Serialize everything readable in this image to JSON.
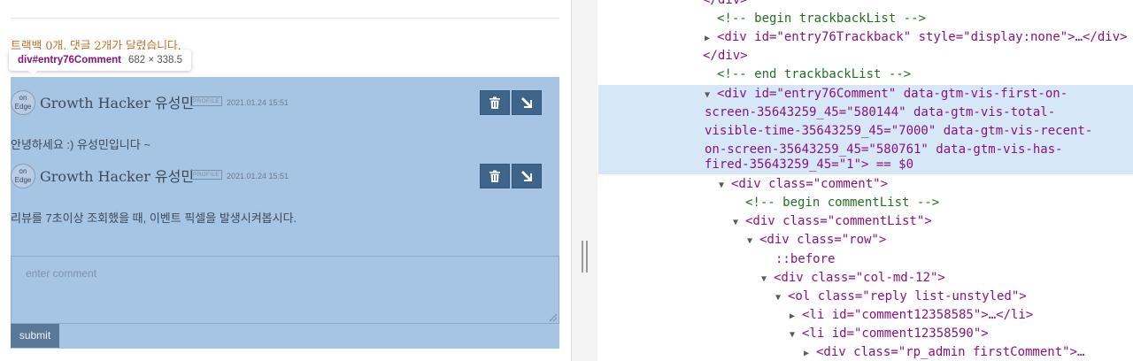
{
  "page": {
    "trackback_summary": "트랙백 0개, 댓글 2개가 달렸습니다.",
    "tooltip": {
      "selector": "div#entry76Comment",
      "dimensions": "682 × 338.5"
    },
    "avatar_text": "on Edge",
    "comments": [
      {
        "author": "Growth Hacker 유성민",
        "badge": "PROFILE",
        "timestamp": "2021.01.24 15:51",
        "body": "안녕하세요 :) 유성민입니다 ~"
      },
      {
        "author": "Growth Hacker 유성민",
        "badge": "PROFILE",
        "timestamp": "2021.01.24 15:51",
        "body": "리뷰를 7초이상 조회했을 때, 이벤트 픽셀을 발생시켜봅시다."
      }
    ],
    "comment_placeholder": "enter comment",
    "submit_label": "submit",
    "icons": {
      "delete": "trash-icon",
      "reply": "arrow-down-right-icon"
    }
  },
  "devtools": {
    "lines": {
      "l1": "</div>",
      "l2": "<!-- begin trackbackList -->",
      "l3": "<div id=\"entry76Trackback\" style=\"display:none\">…</div>",
      "l4": "</div>",
      "l5": "<!-- end trackbackList -->",
      "l6": "<div id=\"entry76Comment\" data-gtm-vis-first-on-",
      "l7": "screen-35643259_45=\"580144\" data-gtm-vis-total-",
      "l8": "visible-time-35643259_45=\"7000\" data-gtm-vis-recent-",
      "l9": "on-screen-35643259_45=\"580761\" data-gtm-vis-has-",
      "l10": "fired-35643259_45=\"1\"> == $0",
      "l11": "<div class=\"comment\">",
      "l12": "<!-- begin commentList -->",
      "l13": "<div class=\"commentList\">",
      "l14": "<div class=\"row\">",
      "l15": "::before",
      "l16": "<div class=\"col-md-12\">",
      "l17": "<ol class=\"reply list-unstyled\">",
      "l18": "<li id=\"comment12358585\">…</li>",
      "l19": "<li id=\"comment12358590\">",
      "l20": "<div class=\"rp_admin firstComment\">…"
    }
  }
}
